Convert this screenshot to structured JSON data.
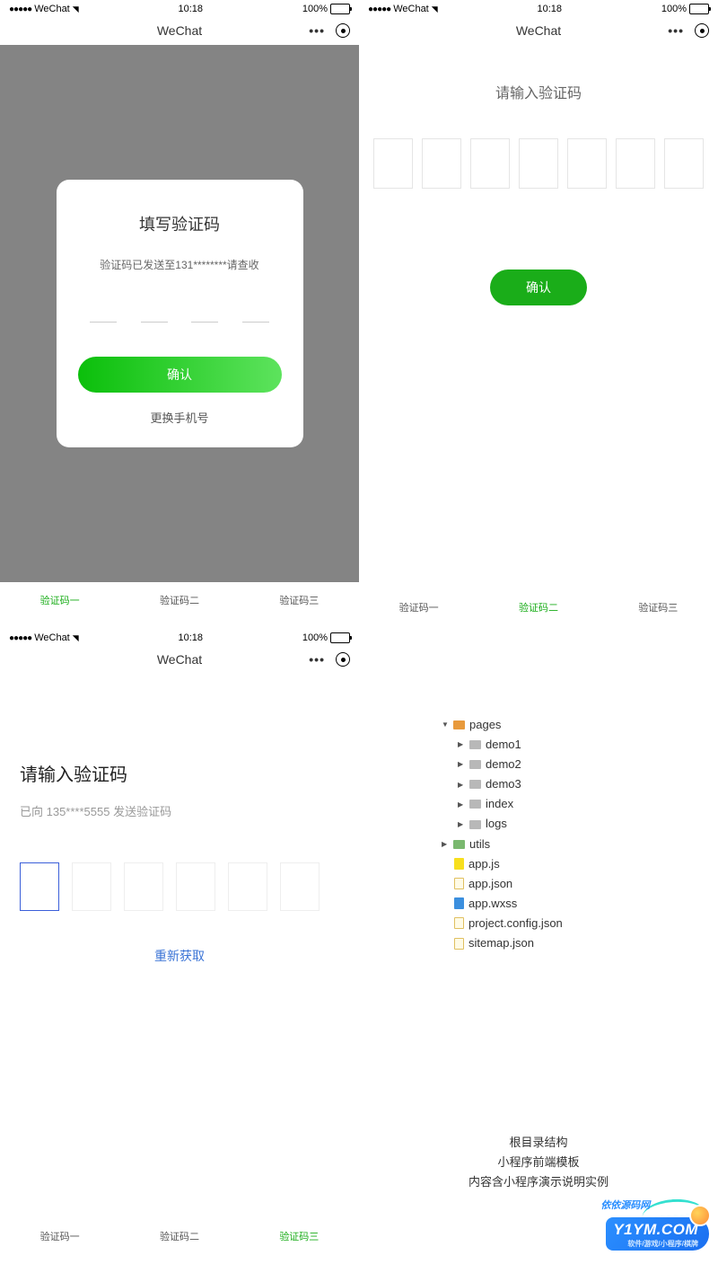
{
  "status": {
    "carrier": "WeChat",
    "time": "10:18",
    "battery": "100%"
  },
  "titlebar": {
    "title": "WeChat"
  },
  "p1": {
    "title": "填写验证码",
    "sub": "验证码已发送至131********请查收",
    "confirm": "确认",
    "change": "更换手机号"
  },
  "p2": {
    "title": "请输入验证码",
    "confirm": "确认"
  },
  "p3": {
    "title": "请输入验证码",
    "sub": "已向 135****5555 发送验证码",
    "resend": "重新获取"
  },
  "tabs": {
    "t1": "验证码一",
    "t2": "验证码二",
    "t3": "验证码三"
  },
  "tree": {
    "pages": "pages",
    "demo1": "demo1",
    "demo2": "demo2",
    "demo3": "demo3",
    "index": "index",
    "logs": "logs",
    "utils": "utils",
    "appjs": "app.js",
    "appjson": "app.json",
    "appwxss": "app.wxss",
    "project": "project.config.json",
    "sitemap": "sitemap.json"
  },
  "desc": {
    "l1": "根目录结构",
    "l2": "小程序前端模板",
    "l3": "内容含小程序演示说明实例"
  },
  "badge": {
    "top": "依依源码网",
    "main": "Y1YM.COM",
    "sub": "软件/游戏/小程序/棋牌"
  }
}
